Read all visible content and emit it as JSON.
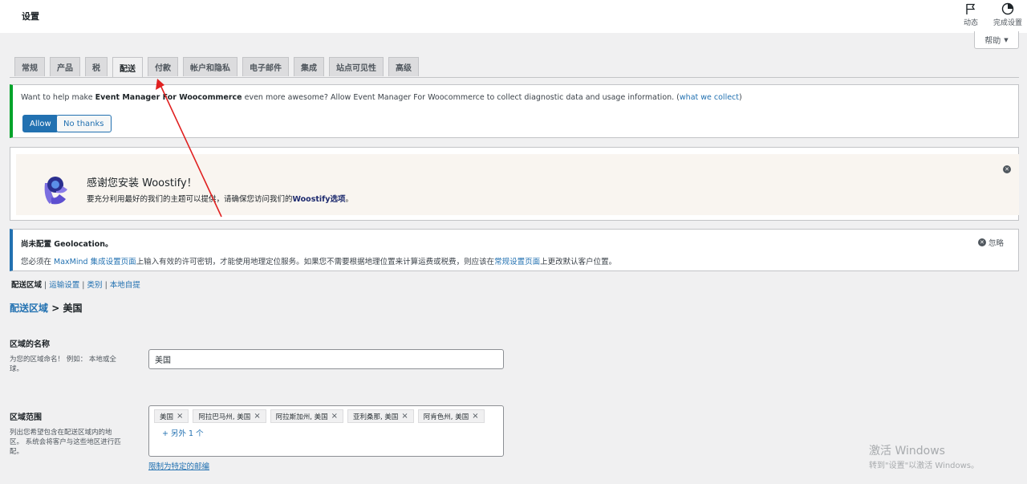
{
  "header": {
    "title": "设置",
    "activity_label": "动态",
    "finish_label": "完成设置",
    "help_label": "帮助"
  },
  "tabs": [
    {
      "label": "常规"
    },
    {
      "label": "产品"
    },
    {
      "label": "税"
    },
    {
      "label": "配送",
      "active": true
    },
    {
      "label": "付款"
    },
    {
      "label": "帐户和隐私"
    },
    {
      "label": "电子邮件"
    },
    {
      "label": "集成"
    },
    {
      "label": "站点可见性"
    },
    {
      "label": "高级"
    }
  ],
  "notice_tracking": {
    "text_before": "Want to help make ",
    "plugin_name": "Event Manager For Woocommerce",
    "text_after": " even more awesome? Allow Event Manager For Woocommerce to collect diagnostic data and usage information. (",
    "link": "what we collect",
    "text_end": ")",
    "allow_label": "Allow",
    "decline_label": "No thanks"
  },
  "notice_woostify": {
    "title": "感谢您安装 Woostify！",
    "desc_before": "要充分利用最好的我们的主题可以提供，请确保您访问我们的",
    "desc_link": "Woostify选项",
    "desc_after": "。"
  },
  "notice_geo": {
    "title": "尚未配置 Geolocation。",
    "d1": "您必须在 ",
    "link1": "MaxMind 集成设置页面",
    "d2": "上输入有效的许可密钥，才能使用地理定位服务。如果您不需要根据地理位置来计算运费或税费，则应该在",
    "link2": "常规设置页面",
    "d3": "上更改默认客户位置。",
    "dismiss_label": "忽略"
  },
  "subnav": {
    "current": "配送区域",
    "items": [
      "运输设置",
      "类别",
      "本地自提"
    ],
    "sep": " | "
  },
  "breadcrumb": {
    "link": "配送区域",
    "sep": " > ",
    "current": "美国"
  },
  "zone_name": {
    "label": "区域的名称",
    "help": "为您的区域命名！ 例如： 本地或全球。",
    "value": "美国"
  },
  "zone_regions": {
    "label": "区域范围",
    "help": "列出您希望包含在配送区域内的地区。 系统会将客户与这些地区进行匹配。",
    "chips": [
      "美国",
      "阿拉巴马州, 美国",
      "阿拉斯加州, 美国",
      "亚利桑那, 美国",
      "阿肯色州, 美国"
    ],
    "more": "+ 另外 1 个",
    "limit_link": "限制为特定的邮编"
  },
  "watermark": {
    "line1": "激活 Windows",
    "line2": "转到\"设置\"以激活 Windows。"
  },
  "colors": {
    "accent": "#2271b1",
    "success": "#00a32a",
    "annotation": "#e02020"
  }
}
